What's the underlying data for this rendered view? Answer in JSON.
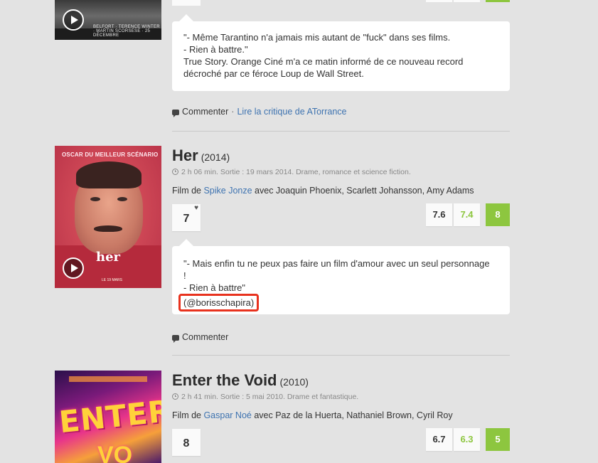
{
  "films": [
    {
      "id": "wolf",
      "poster_text": "BELFORT · TERENCE WINTER · MARTIN SCORSESE · 25 DÉCEMBRE",
      "review_lines": [
        "\"- Même Tarantino n'a jamais mis autant de \"fuck\" dans ses films.",
        "- Rien à battre.\"",
        "True Story. Orange Ciné m'a ce matin informé de ce nouveau record",
        "décroché par ce féroce Loup de Wall Street."
      ],
      "comment_label": "Commenter",
      "separator": "·",
      "critique_link": "Lire la critique de ATorrance"
    },
    {
      "id": "her",
      "title": "Her",
      "year": "(2014)",
      "meta": "2 h 06 min. Sortie : 19 mars 2014. Drame, romance et science fiction.",
      "credits_prefix": "Film de ",
      "director": "Spike Jonze",
      "credits_suffix": " avec Joaquin Phoenix, Scarlett Johansson, Amy Adams",
      "poster_top_text": "OSCAR DU MEILLEUR SCÉNARIO",
      "poster_title": "her",
      "poster_date": "LE 19 MARS",
      "user_score": "7",
      "ratings": [
        "7.6",
        "7.4",
        "8"
      ],
      "review_lines": [
        "\"- Mais enfin tu ne peux pas faire un film d'amour avec un seul personnage",
        "!",
        "- Rien à battre\""
      ],
      "review_handle": "(@borisschapira)",
      "comment_label": "Commenter"
    },
    {
      "id": "void",
      "title": "Enter the Void",
      "year": "(2010)",
      "meta": "2 h 41 min. Sortie : 5 mai 2010. Drame et fantastique.",
      "credits_prefix": "Film de ",
      "director": "Gaspar Noé",
      "credits_suffix": " avec Paz de la Huerta, Nathaniel Brown, Cyril Roy",
      "poster_title": "ENTER",
      "poster_sub": "VO",
      "user_score": "8",
      "ratings": [
        "6.7",
        "6.3",
        "5"
      ]
    }
  ],
  "colors": {
    "background": "#e3e3e3",
    "link": "#3e73b0",
    "rating_green": "#8dc63f",
    "highlight_red": "#e8321e"
  },
  "icons": [
    "play-icon",
    "clock-icon",
    "heart-icon",
    "comment-icon"
  ]
}
